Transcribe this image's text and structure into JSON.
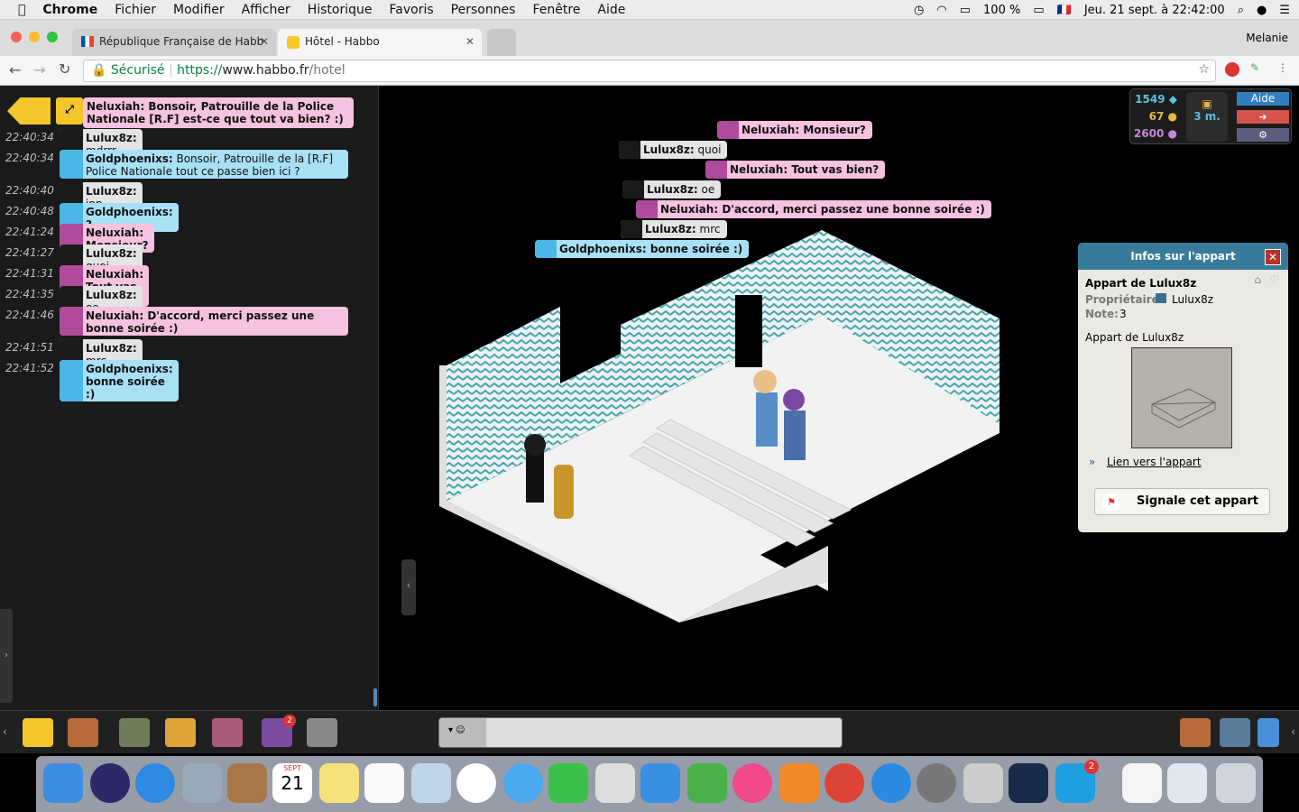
{
  "menubar": {
    "app": "Chrome",
    "items": [
      "Fichier",
      "Modifier",
      "Afficher",
      "Historique",
      "Favoris",
      "Personnes",
      "Fenêtre",
      "Aide"
    ],
    "battery": "100 %",
    "datetime": "Jeu. 21 sept. à 22:42:00"
  },
  "browser": {
    "tabs": [
      {
        "title": "République Française de Habb"
      },
      {
        "title": "Hôtel - Habbo"
      }
    ],
    "profile": "Melanie",
    "secure_label": "Sécurisé",
    "url_scheme": "https://",
    "url_host": "www.habbo.fr",
    "url_path": "/hotel"
  },
  "chatlog": [
    {
      "time": "",
      "user": "Neluxiah:",
      "text": " Bonsoir, Patrouille de la Police Nationale [R.F] est-ce que tout va bien? :)",
      "color": "pink",
      "bold": true
    },
    {
      "time": "22:40:34",
      "user": "Lulux8z:",
      "text": " mdrrr",
      "color": "grey"
    },
    {
      "time": "22:40:34",
      "user": "Goldphoenixs:",
      "text": " Bonsoir, Patrouille de la [R.F] Police Nationale tout ce passe bien ici ?",
      "color": "blue"
    },
    {
      "time": "22:40:40",
      "user": "Lulux8z:",
      "text": " jpp",
      "color": "grey"
    },
    {
      "time": "22:40:48",
      "user": "Goldphoenixs:",
      "text": " ?",
      "color": "blue",
      "bold": true
    },
    {
      "time": "22:41:24",
      "user": "Neluxiah:",
      "text": " Monsieur?",
      "color": "pink",
      "bold": true
    },
    {
      "time": "22:41:27",
      "user": "Lulux8z:",
      "text": " quoi",
      "color": "grey"
    },
    {
      "time": "22:41:31",
      "user": "Neluxiah:",
      "text": " Tout vas bien?",
      "color": "pink",
      "bold": true
    },
    {
      "time": "22:41:35",
      "user": "Lulux8z:",
      "text": " oe",
      "color": "grey"
    },
    {
      "time": "22:41:46",
      "user": "Neluxiah:",
      "text": " D'accord, merci passez une bonne soirée :)",
      "color": "pink",
      "bold": true
    },
    {
      "time": "22:41:51",
      "user": "Lulux8z:",
      "text": " mrc",
      "color": "grey"
    },
    {
      "time": "22:41:52",
      "user": "Goldphoenixs:",
      "text": " bonne soirée :)",
      "color": "blue",
      "bold": true
    }
  ],
  "room_chat": [
    {
      "user": "Neluxiah:",
      "text": " Monsieur?",
      "color": "pink"
    },
    {
      "user": "Lulux8z:",
      "text": " quoi",
      "color": "grey"
    },
    {
      "user": "Neluxiah:",
      "text": " Tout vas bien?",
      "color": "pink"
    },
    {
      "user": "Lulux8z:",
      "text": " oe",
      "color": "grey"
    },
    {
      "user": "Neluxiah:",
      "text": " D'accord, merci passez une bonne soirée :)",
      "color": "pink"
    },
    {
      "user": "Lulux8z:",
      "text": " mrc",
      "color": "grey"
    },
    {
      "user": "Goldphoenixs:",
      "text": " bonne soirée :)",
      "color": "blue"
    }
  ],
  "hud": {
    "diamonds": "1549",
    "credits": "67",
    "duckets": "2600",
    "hc": "3 m.",
    "help": "Aide"
  },
  "room_info": {
    "title": "Infos sur l'appart",
    "name": "Appart de Lulux8z",
    "owner_label": "Propriétaire:",
    "owner": "Lulux8z",
    "rating_label": "Note:",
    "rating": "3",
    "description": "Appart de Lulux8z",
    "link": "Lien vers l'appart",
    "report": "Signale cet appart"
  },
  "colors": {
    "pink": "#f5c2e0",
    "grey": "#e4e4e4",
    "blue": "#a8e0f6",
    "panel_header": "#387a9a"
  },
  "dock_badges": {
    "calendar_day": "21",
    "calendar_month": "SEPT",
    "notifications": "2"
  }
}
